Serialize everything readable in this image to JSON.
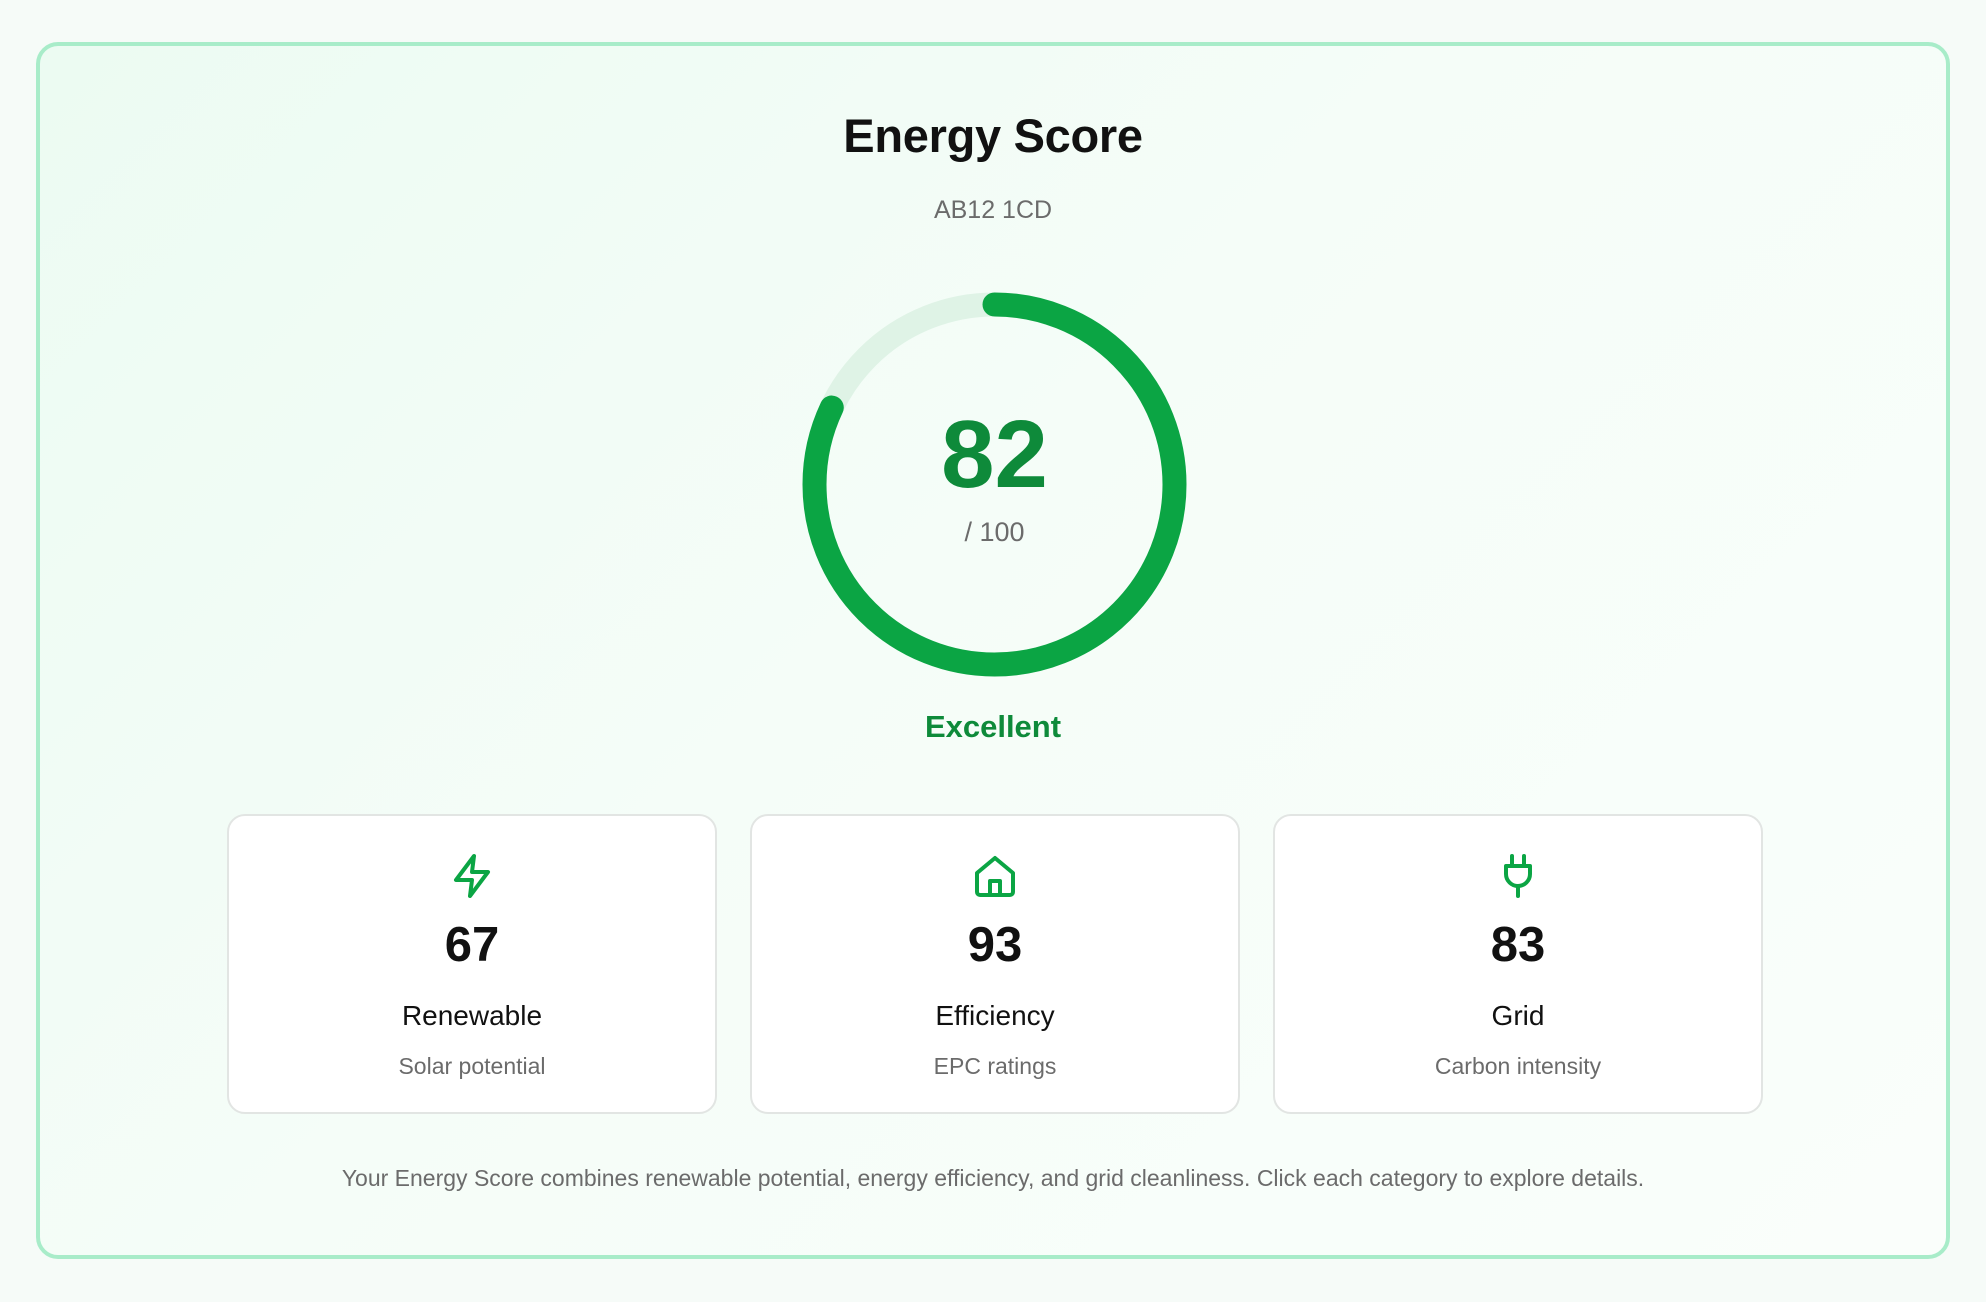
{
  "header": {
    "title": "Energy Score",
    "postcode": "AB12 1CD"
  },
  "score": {
    "value": "82",
    "max_label": "/ 100",
    "fraction": 0.82,
    "rating": "Excellent"
  },
  "categories": [
    {
      "icon": "lightning-icon",
      "value": "67",
      "name": "Renewable",
      "description": "Solar potential"
    },
    {
      "icon": "house-icon",
      "value": "93",
      "name": "Efficiency",
      "description": "EPC ratings"
    },
    {
      "icon": "plug-icon",
      "value": "83",
      "name": "Grid",
      "description": "Carbon intensity"
    }
  ],
  "footer": {
    "note": "Your Energy Score combines renewable potential, energy efficiency, and grid cleanliness. Click each category to explore details."
  },
  "colors": {
    "accent": "#0ba544",
    "accent_text": "#0e8a3a",
    "card_border": "#a8ecc9"
  }
}
